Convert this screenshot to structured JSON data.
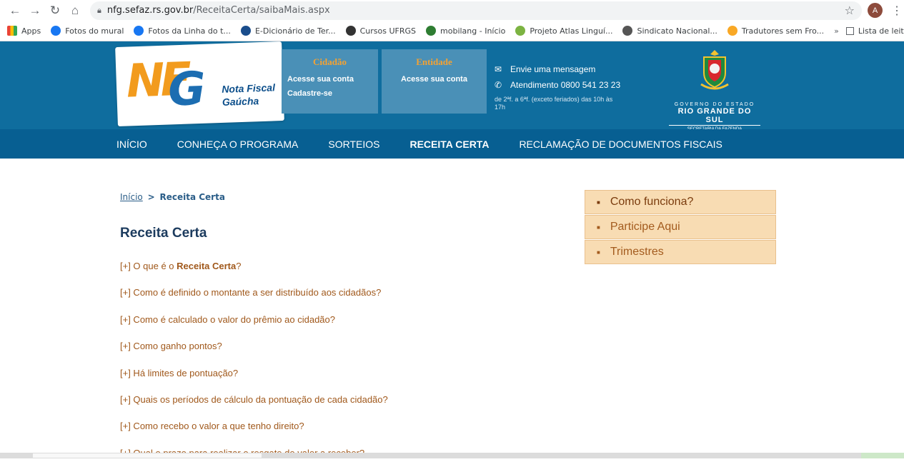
{
  "browser": {
    "url_host": "nfg.sefaz.rs.gov.br",
    "url_path": "/ReceitaCerta/saibaMais.aspx",
    "avatar_letter": "A",
    "bookmarks": [
      {
        "label": "Apps",
        "icon": "apps-icon",
        "color": "#ea4335"
      },
      {
        "label": "Fotos do mural",
        "icon": "facebook-icon",
        "color": "#1877f2"
      },
      {
        "label": "Fotos da Linha do t...",
        "icon": "facebook-icon",
        "color": "#1877f2"
      },
      {
        "label": "E-Dicionário de Ter...",
        "icon": "dictionary-icon",
        "color": "#1a4d8c"
      },
      {
        "label": "Cursos UFRGS",
        "icon": "shield-icon",
        "color": "#333333"
      },
      {
        "label": "mobilang - Início",
        "icon": "flag-icon",
        "color": "#2e7d32"
      },
      {
        "label": "Projeto Atlas Linguí...",
        "icon": "leaf-icon",
        "color": "#7cb342"
      },
      {
        "label": "Sindicato Nacional...",
        "icon": "globe-icon",
        "color": "#555555"
      },
      {
        "label": "Tradutores sem Fro...",
        "icon": "bookmark-icon",
        "color": "#f9a825"
      }
    ],
    "more": "»",
    "reading_list": "Lista de leitura"
  },
  "header": {
    "logo": {
      "letters_nf": "NF",
      "letter_g": "G",
      "line1": "Nota Fiscal",
      "line2": "Gaúcha"
    },
    "cidadao": {
      "title": "Cidadão",
      "link1": "Acesse sua conta",
      "link2": "Cadastre-se"
    },
    "entidade": {
      "title": "Entidade",
      "link1": "Acesse sua conta"
    },
    "contact": {
      "message": "Envie uma mensagem",
      "phone": "Atendimento 0800 541 23 23",
      "hours": "de 2ªf. a 6ªf. (exceto feriados) das 10h às 17h"
    },
    "gov": {
      "line1": "GOVERNO DO ESTADO",
      "line2": "RIO GRANDE DO SUL",
      "line3": "SECRETARIA DA FAZENDA"
    }
  },
  "nav": {
    "items": [
      "INÍCIO",
      "CONHEÇA O PROGRAMA",
      "SORTEIOS",
      "RECEITA CERTA",
      "RECLAMAÇÃO DE DOCUMENTOS FISCAIS"
    ],
    "active": "RECEITA CERTA"
  },
  "breadcrumb": {
    "home": "Início",
    "sep": ">",
    "current": "Receita Certa"
  },
  "page_title": "Receita Certa",
  "faq": {
    "first_prefix": "[+] O que é o ",
    "first_bold": "Receita Certa",
    "first_suffix": "?",
    "items": [
      "[+] Como é definido o montante a ser distribuído aos cidadãos?",
      "[+] Como é calculado o valor do prêmio ao cidadão?",
      "[+] Como ganho pontos?",
      "[+] Há limites de pontuação?",
      "[+] Quais os períodos de cálculo da pontuação de cada cidadão?",
      "[+] Como recebo o valor a que tenho direito?",
      "[+] Qual o prazo para realizar o resgate do valor a receber?"
    ]
  },
  "side_menu": [
    "Como funciona?",
    "Participe Aqui",
    "Trimestres"
  ],
  "colors": {
    "header_blue": "#0f6d9e",
    "nav_blue": "#075f92",
    "link_orange": "#a0581b",
    "side_bg": "#f8dcb3"
  }
}
